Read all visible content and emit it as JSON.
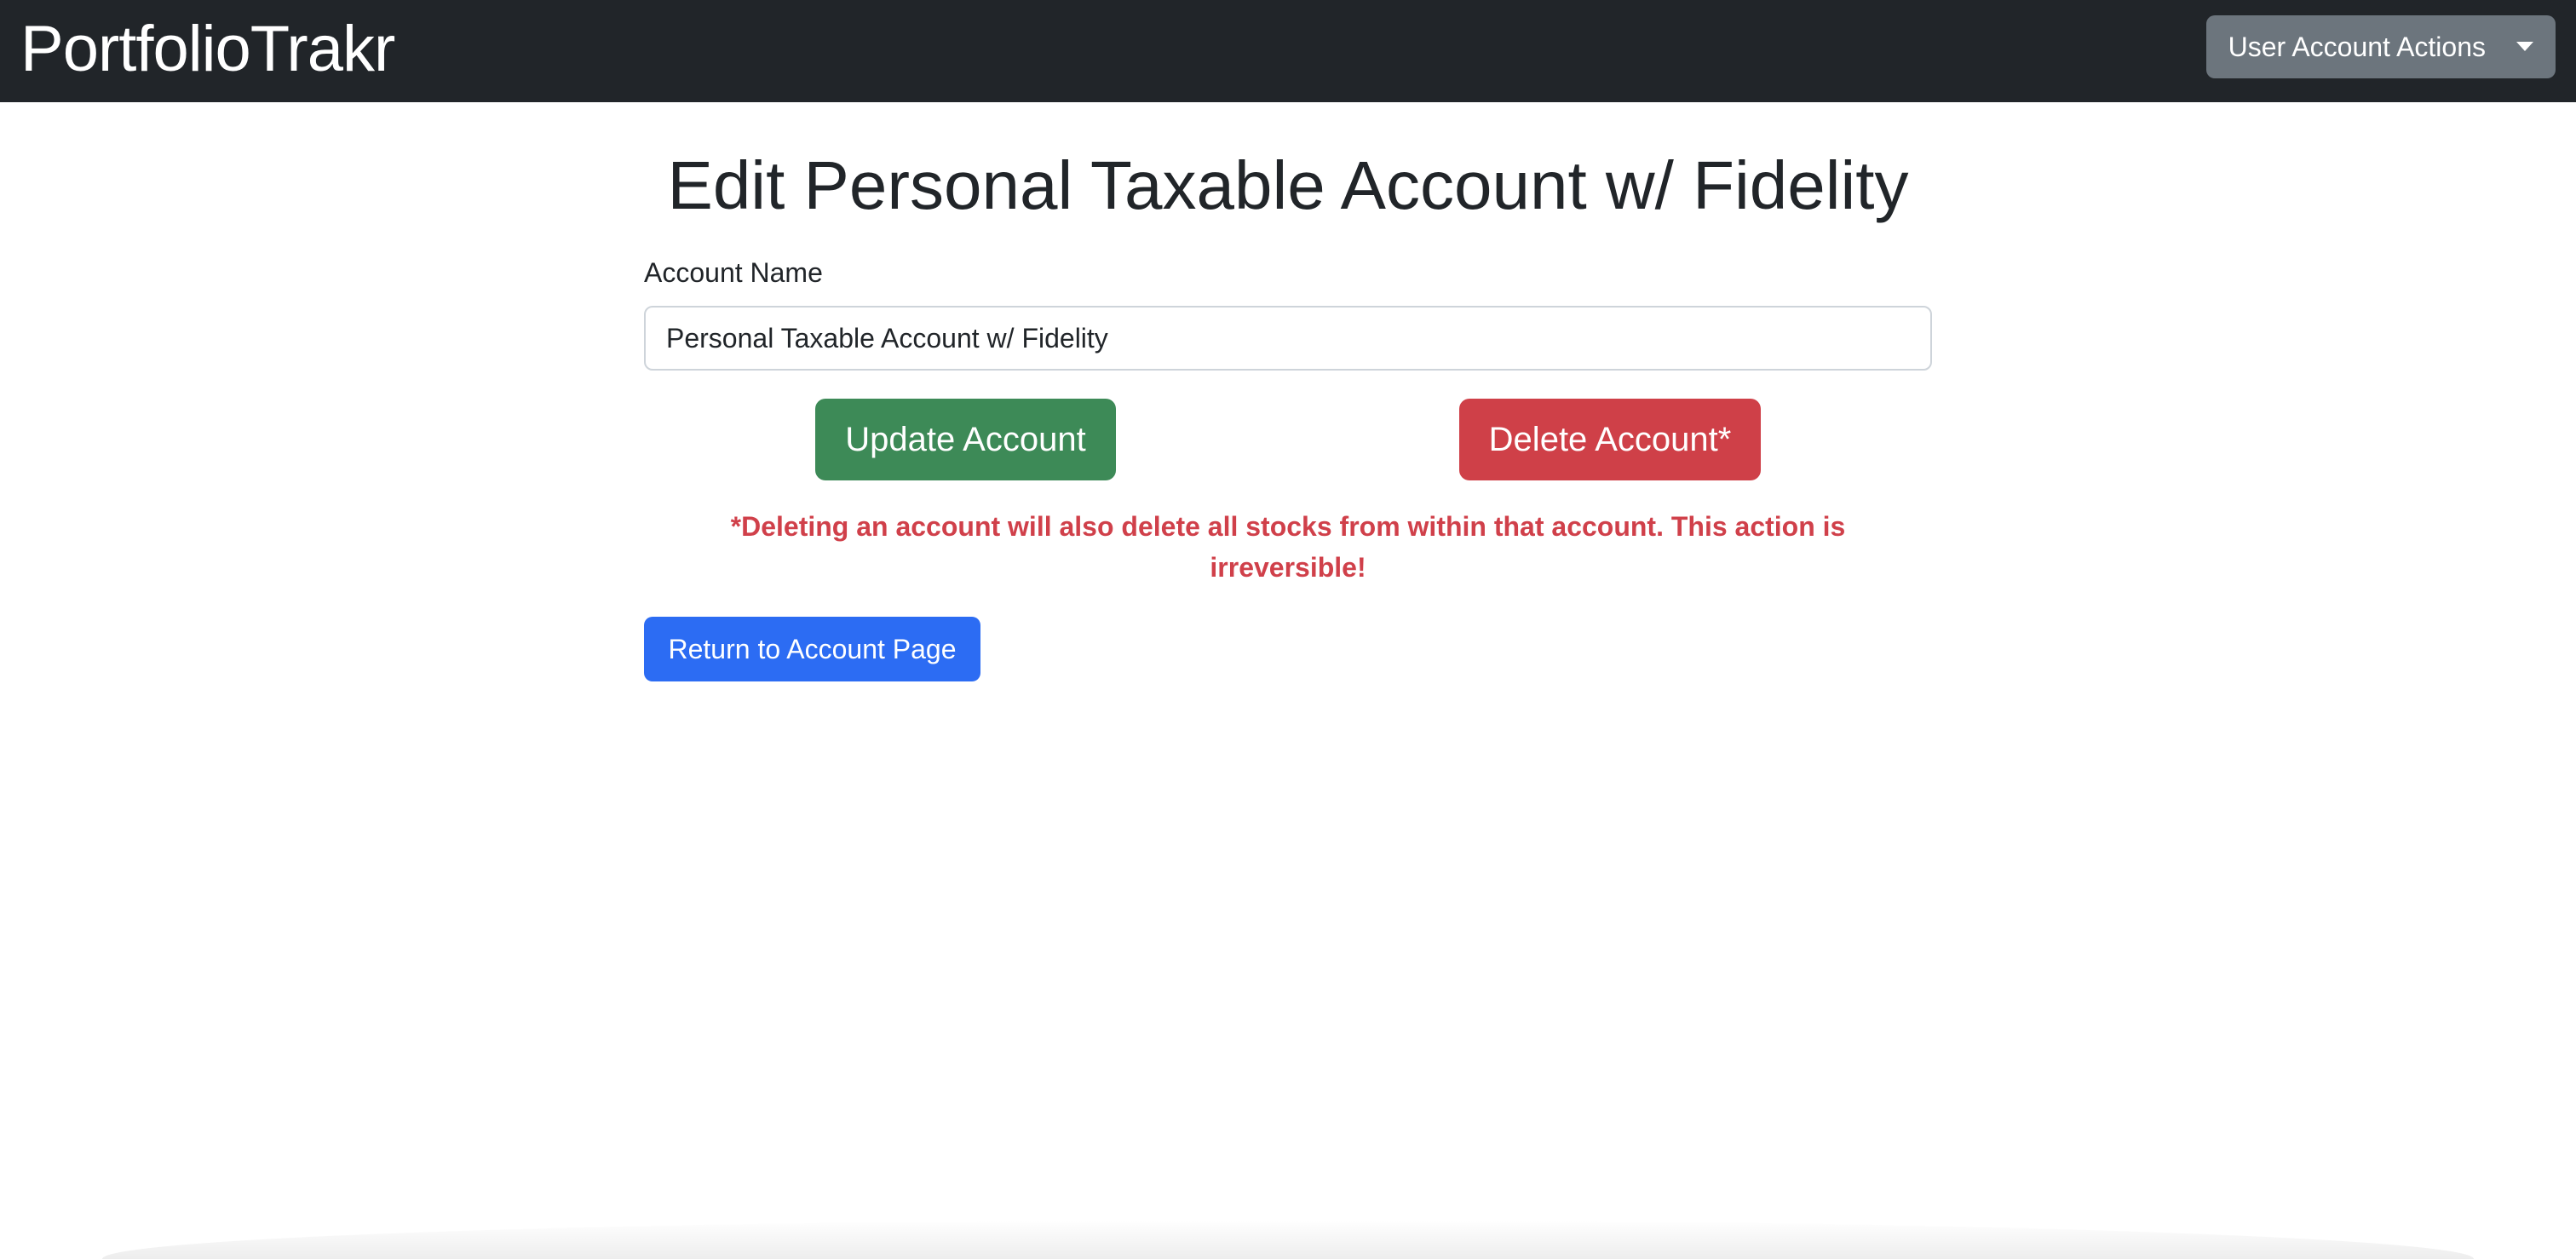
{
  "navbar": {
    "brand": "PortfolioTrakr",
    "user_actions_label": "User Account Actions"
  },
  "main": {
    "title": "Edit Personal Taxable Account w/ Fidelity",
    "account_name_label": "Account Name",
    "account_name_value": "Personal Taxable Account w/ Fidelity",
    "update_button": "Update Account",
    "delete_button": "Delete Account*",
    "delete_warning": "*Deleting an account will also delete all stocks from within that account. This action is irreversible!",
    "return_button": "Return to Account Page"
  },
  "colors": {
    "navbar_bg": "#212529",
    "secondary": "#6c757d",
    "success": "#3d8a57",
    "danger": "#cf4048",
    "primary": "#2c6cf3"
  },
  "icons": {
    "dropdown": "caret-down-icon"
  }
}
